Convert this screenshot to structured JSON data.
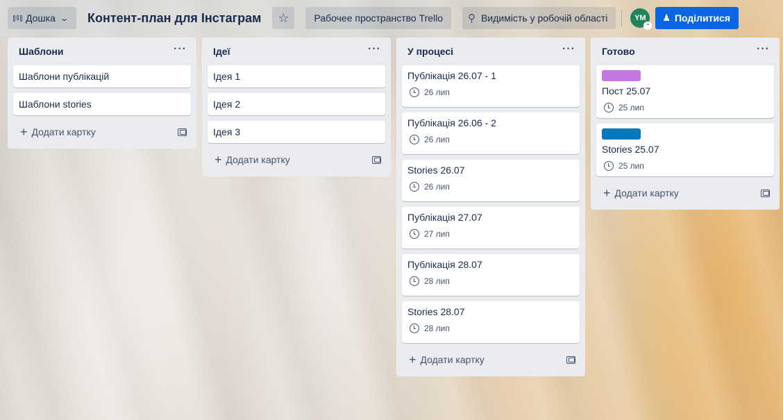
{
  "topbar": {
    "board_label": "Дошка",
    "board_title": "Контент-план для Інстаграм",
    "workspace_label": "Рабочее пространство Trello",
    "visibility_label": "Видимість у робочій області",
    "avatar_initials": "YM",
    "share_label": "Поділитися"
  },
  "add_card_label": "Додати картку",
  "colors": {
    "accent": "#0c66e4",
    "label_purple": "#c377e0",
    "label_blue": "#0079bf",
    "avatar": "#1f845a"
  },
  "lists": [
    {
      "title": "Шаблони",
      "cards": [
        {
          "title": "Шаблони публікацій"
        },
        {
          "title": "Шаблони stories"
        }
      ]
    },
    {
      "title": "Ідеї",
      "cards": [
        {
          "title": "Ідея 1"
        },
        {
          "title": "Ідея 2"
        },
        {
          "title": "Ідея 3"
        }
      ]
    },
    {
      "title": "У процесі",
      "cards": [
        {
          "title": "Публікація 26.07 - 1",
          "date": "26 лип"
        },
        {
          "title": "Публікація 26.06 - 2",
          "date": "26 лип"
        },
        {
          "title": "Stories 26.07",
          "date": "26 лип"
        },
        {
          "title": "Публікація 27.07",
          "date": "27 лип"
        },
        {
          "title": "Публікація 28.07",
          "date": "28 лип"
        },
        {
          "title": "Stories 28.07",
          "date": "28 лип"
        }
      ]
    },
    {
      "title": "Готово",
      "cards": [
        {
          "title": "Пост 25.07",
          "date": "25 лип",
          "label_color": "#c377e0"
        },
        {
          "title": "Stories 25.07",
          "date": "25 лип",
          "label_color": "#0079bf"
        }
      ]
    }
  ]
}
